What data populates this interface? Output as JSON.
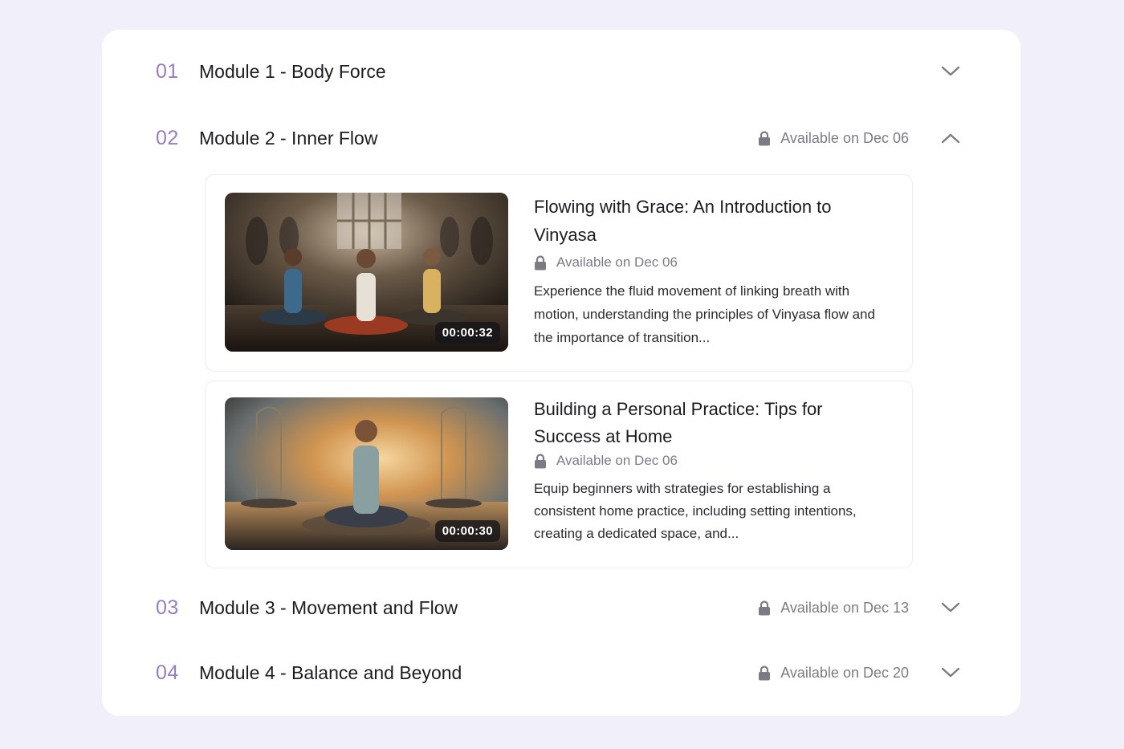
{
  "modules": [
    {
      "num": "01",
      "title": "Module 1 - Body Force",
      "available": "",
      "expanded": false
    },
    {
      "num": "02",
      "title": "Module 2 - Inner Flow",
      "available": "Available on Dec 06",
      "expanded": true
    },
    {
      "num": "03",
      "title": "Module 3 - Movement and Flow",
      "available": "Available on Dec 13",
      "expanded": false
    },
    {
      "num": "04",
      "title": "Module 4 - Balance and Beyond",
      "available": "Available on Dec 20",
      "expanded": false
    }
  ],
  "lessons": [
    {
      "title": "Flowing with Grace: An Introduction to Vinyasa",
      "available": "Available on Dec 06",
      "description": "Experience the fluid movement of linking breath with motion, understanding the principles of Vinyasa flow and the importance of transition...",
      "duration": "00:00:32"
    },
    {
      "title": "Building a Personal Practice: Tips for Success at Home",
      "available": "Available on Dec 06",
      "description": "Equip beginners with strategies for establishing a consistent home practice, including setting intentions, creating a dedicated space, and...",
      "duration": "00:00:30"
    }
  ],
  "colors": {
    "accent": "#9a7cc0",
    "muted": "#7b7b86",
    "background": "#f1f0fa"
  },
  "icons": {
    "lock": "lock-icon",
    "expand": "chevron-down-icon",
    "collapse": "chevron-up-icon"
  }
}
